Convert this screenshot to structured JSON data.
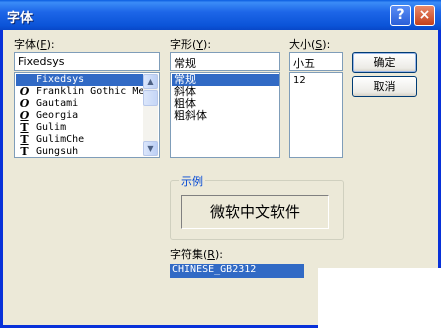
{
  "title": "字体",
  "titlebar": {
    "help": "?",
    "close": "×"
  },
  "font": {
    "label": "字体(",
    "accel": "F",
    "label_end": "):",
    "value": "Fixedsys",
    "items": [
      {
        "icon": "",
        "name": "Fixedsys"
      },
      {
        "icon": "O",
        "name": "Franklin Gothic Me"
      },
      {
        "icon": "O",
        "name": "Gautami"
      },
      {
        "icon": "O",
        "name": "Georgia"
      },
      {
        "icon": "T",
        "name": "Gulim"
      },
      {
        "icon": "T",
        "name": "GulimChe"
      },
      {
        "icon": "T",
        "name": "Gungsuh"
      }
    ]
  },
  "style": {
    "label": "字形(",
    "accel": "Y",
    "label_end": "):",
    "value": "常规",
    "items": [
      "常规",
      "斜体",
      "粗体",
      "粗斜体"
    ]
  },
  "size": {
    "label": "大小(",
    "accel": "S",
    "label_end": "):",
    "value": "小五",
    "items": [
      "12"
    ]
  },
  "buttons": {
    "ok": "确定",
    "cancel": "取消"
  },
  "sample": {
    "title": "示例",
    "text": "微软中文软件"
  },
  "script": {
    "label": "字符集(",
    "accel": "R",
    "label_end": "):",
    "value": "CHINESE_GB2312"
  }
}
